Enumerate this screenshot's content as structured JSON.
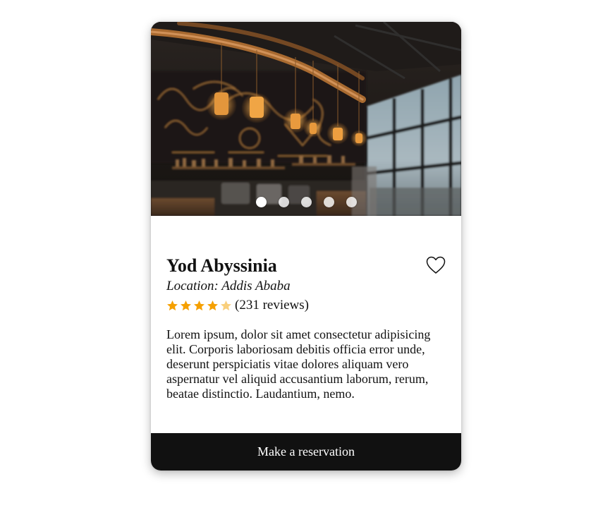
{
  "card": {
    "hero": {
      "image_alt": "Cafe interior with pendant lights",
      "dot_count": 5,
      "active_dot": 0
    },
    "title": "Yod Abyssinia",
    "location": "Location: Addis Ababa",
    "rating": {
      "value": 4.5,
      "max": 5,
      "reviews_text": "(231 reviews)"
    },
    "description": "Lorem ipsum, dolor sit amet consectetur adipisicing elit. Corporis laboriosam debitis officia error unde, deserunt perspiciatis vitae dolores aliquam vero aspernatur vel aliquid accusantium laborum, rerum, beatae distinctio. Laudantium, nemo.",
    "cta_label": "Make a reservation",
    "icons": {
      "favorite": "heart-outline-icon",
      "star": "star-icon"
    },
    "colors": {
      "star": "#f5a000",
      "star_faded": "#f9cf7c",
      "button_bg": "#111111",
      "button_text": "#ffffff"
    }
  }
}
